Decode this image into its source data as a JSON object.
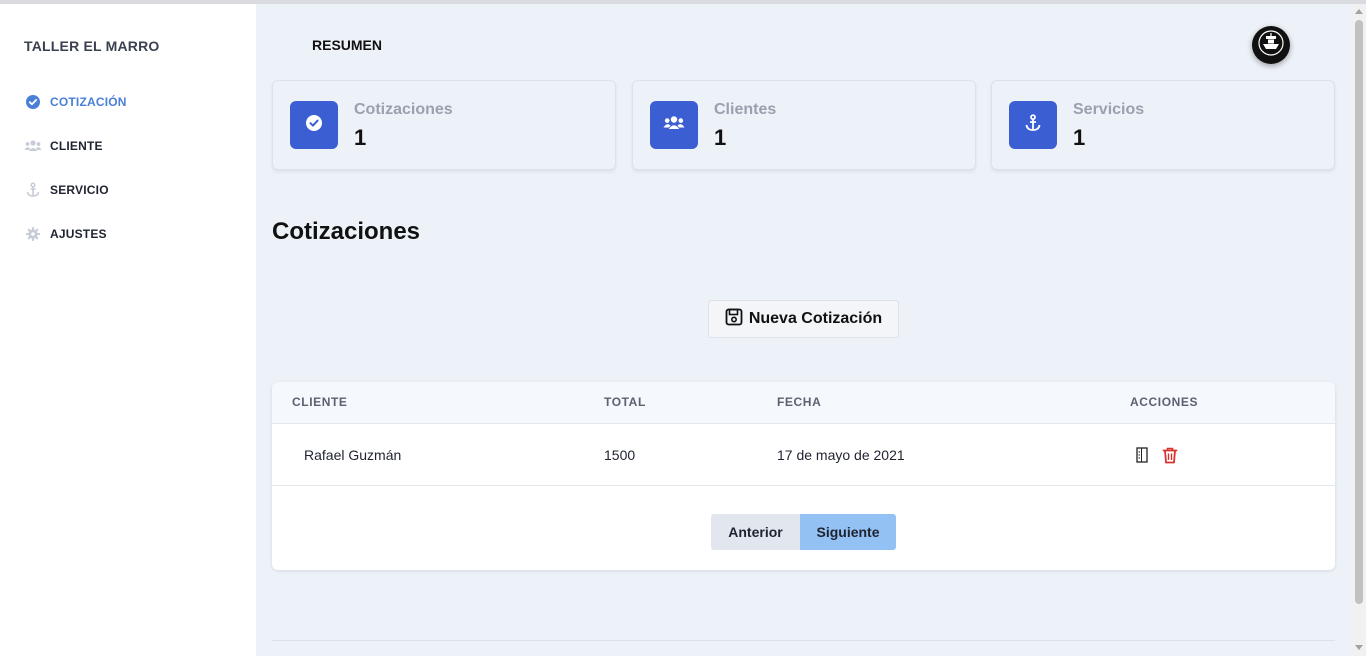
{
  "app": {
    "brand": "TALLER EL MARRO"
  },
  "sidebar": {
    "items": [
      {
        "label": "COTIZACIÓN",
        "icon": "check-circle-icon",
        "active": true
      },
      {
        "label": "CLIENTE",
        "icon": "users-icon",
        "active": false
      },
      {
        "label": "SERVICIO",
        "icon": "anchor-icon",
        "active": false
      },
      {
        "label": "AJUSTES",
        "icon": "gear-icon",
        "active": false
      }
    ]
  },
  "header": {
    "title": "RESUMEN",
    "avatar_icon": "ship-logo-icon"
  },
  "stats": [
    {
      "label": "Cotizaciones",
      "value": "1",
      "icon": "check-circle-icon"
    },
    {
      "label": "Clientes",
      "value": "1",
      "icon": "users-icon"
    },
    {
      "label": "Servicios",
      "value": "1",
      "icon": "anchor-icon"
    }
  ],
  "section": {
    "title": "Cotizaciones",
    "new_button_label": "Nueva Cotización",
    "new_button_icon": "save-icon"
  },
  "table": {
    "columns": [
      "CLIENTE",
      "TOTAL",
      "FECHA",
      "ACCIONES"
    ],
    "rows": [
      {
        "cliente": "Rafael Guzmán",
        "total": "1500",
        "fecha": "17 de mayo de 2021",
        "actions": [
          "document-icon",
          "trash-icon"
        ]
      }
    ]
  },
  "pagination": {
    "prev_label": "Anterior",
    "next_label": "Siguiente"
  },
  "colors": {
    "accent": "#3b5fd3",
    "active_nav": "#4a7fd8",
    "danger": "#d9312b",
    "next_button": "#93c1f3"
  }
}
